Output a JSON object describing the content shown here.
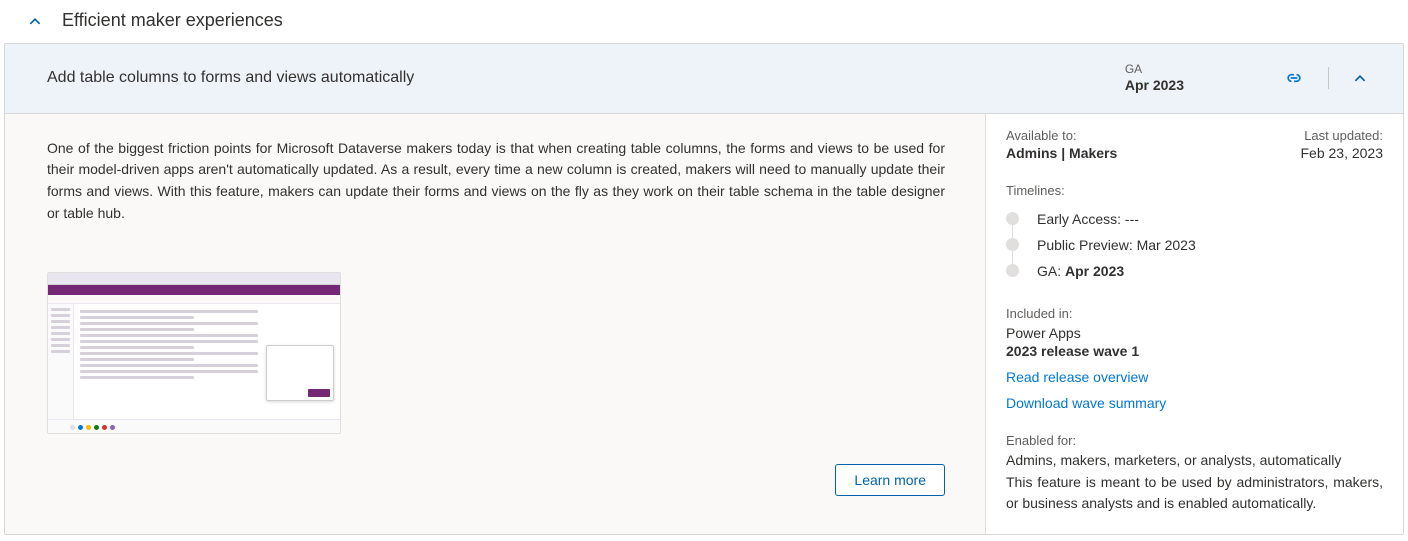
{
  "section": {
    "title": "Efficient maker experiences"
  },
  "feature": {
    "title": "Add table columns to forms and views automatically",
    "ga_label": "GA",
    "ga_date": "Apr 2023",
    "description": "One of the biggest friction points for Microsoft Dataverse makers today is that when creating table columns, the forms and views to be used for their model-driven apps aren't automatically updated. As a result, every time a new column is created, makers will need to manually update their forms and views. With this feature, makers can update their forms and views on the fly as they work on their table schema in the table designer or table hub.",
    "learn_more": "Learn more"
  },
  "side": {
    "available_to_label": "Available to:",
    "available_to": "Admins | Makers",
    "last_updated_label": "Last updated:",
    "last_updated": "Feb 23, 2023",
    "timelines_label": "Timelines:",
    "timelines": [
      {
        "label": "Early Access: ",
        "value": "---",
        "bold": false
      },
      {
        "label": "Public Preview: ",
        "value": "Mar 2023",
        "bold": false
      },
      {
        "label": "GA: ",
        "value": "Apr 2023",
        "bold": true
      }
    ],
    "included_label": "Included in:",
    "included_product": "Power Apps",
    "included_wave": "2023 release wave 1",
    "link_overview": "Read release overview",
    "link_download": "Download wave summary",
    "enabled_for_label": "Enabled for:",
    "enabled_for_who": "Admins, makers, marketers, or analysts, automatically",
    "enabled_for_desc": "This feature is meant to be used by administrators, makers, or business analysts and is enabled automatically."
  }
}
